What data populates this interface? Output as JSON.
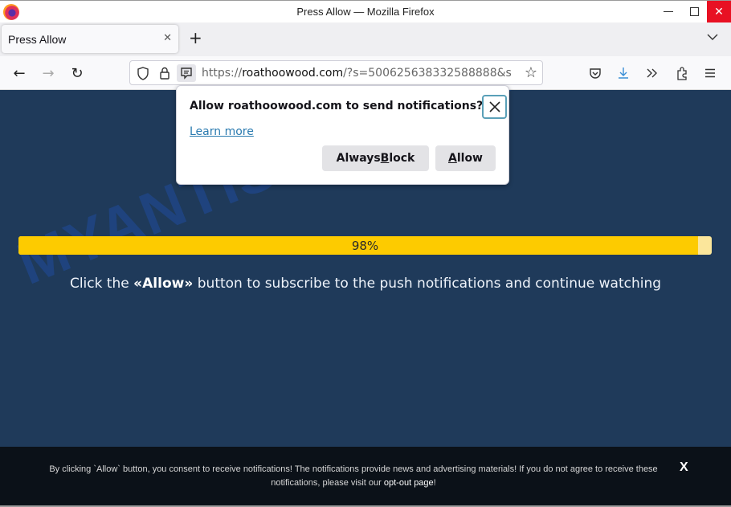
{
  "window": {
    "title": "Press Allow — Mozilla Firefox",
    "controls": {
      "minimize": "—",
      "maximize": "□",
      "close": "✕"
    }
  },
  "tabs": [
    {
      "title": "Press Allow",
      "close": "✕"
    }
  ],
  "tabstrip": {
    "new_tab": "+",
    "list_all": "⌄"
  },
  "nav": {
    "back": "←",
    "forward": "→",
    "reload": "↻",
    "url_scheme": "https://",
    "url_host": "roathoowood.com",
    "url_rest": "/?s=500625638332588888&s",
    "bookmark_star": "☆",
    "icons": [
      "shield-icon",
      "lock-icon",
      "notification-permission-icon",
      "pocket-icon",
      "download-icon",
      "overflow-icon",
      "extensions-icon",
      "menu-icon"
    ]
  },
  "doorhanger": {
    "message": "Allow roathoowood.com to send notifications?",
    "learn_more": "Learn more",
    "block_pre": "Always ",
    "block_access": "B",
    "block_post": "lock",
    "allow_access": "A",
    "allow_post": "llow",
    "close": "✕"
  },
  "page": {
    "watermark": "MYANTISPYWARE.COM",
    "progress_percent": 98,
    "progress_label": "98%",
    "instruction_pre": "Click the ",
    "instruction_bold": "«Allow»",
    "instruction_post": " button to subscribe to the push notifications and continue watching",
    "colors": {
      "background": "#1f3a5a",
      "progress_fill": "#fdcb00",
      "progress_track": "#fbe69b"
    }
  },
  "consent": {
    "text": "By clicking `Allow` button, you consent to receive notifications! The notifications provide news and advertising materials! If you do not agree to receive these notifications, please visit our ",
    "link": "opt-out page",
    "suffix": "!",
    "close": "X"
  }
}
